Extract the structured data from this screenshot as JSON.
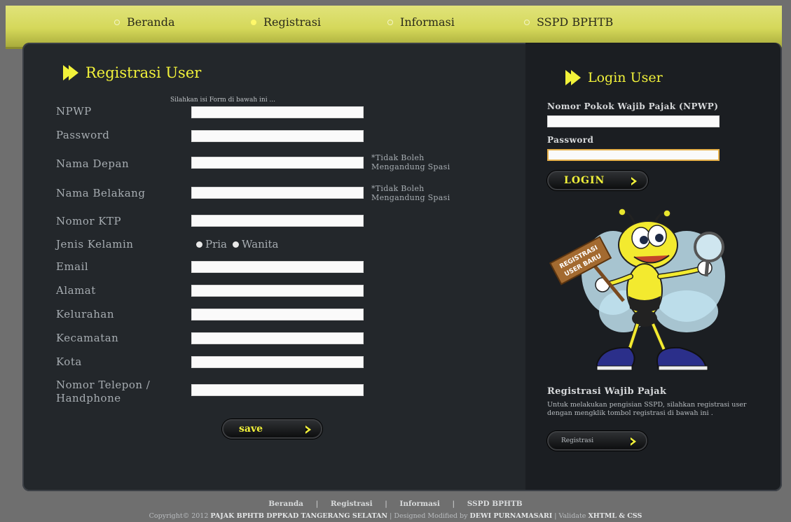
{
  "nav": {
    "items": [
      {
        "label": "Beranda",
        "active": false
      },
      {
        "label": "Registrasi",
        "active": true
      },
      {
        "label": "Informasi",
        "active": false
      },
      {
        "label": "SSPD BPHTB",
        "active": false
      }
    ]
  },
  "registration": {
    "title": "Registrasi User",
    "subtitle": "Silahkan isi Form di bawah ini ...",
    "fields": {
      "npwp": {
        "label": "NPWP",
        "value": ""
      },
      "password": {
        "label": "Password",
        "value": ""
      },
      "nama_depan": {
        "label": "Nama Depan",
        "value": "",
        "note": "*Tidak Boleh Mengandung Spasi"
      },
      "nama_belakang": {
        "label": "Nama Belakang",
        "value": "",
        "note": "*Tidak Boleh Mengandung Spasi"
      },
      "nomor_ktp": {
        "label": "Nomor KTP",
        "value": ""
      },
      "jenis_kelamin": {
        "label": "Jenis Kelamin",
        "options": [
          "Pria",
          "Wanita"
        ]
      },
      "email": {
        "label": "Email",
        "value": ""
      },
      "alamat": {
        "label": "Alamat",
        "value": ""
      },
      "kelurahan": {
        "label": "Kelurahan",
        "value": ""
      },
      "kecamatan": {
        "label": "Kecamatan",
        "value": ""
      },
      "kota": {
        "label": "Kota",
        "value": ""
      },
      "telepon": {
        "label": "Nomor Telepon / Handphone",
        "value": ""
      }
    },
    "save_label": "save"
  },
  "login": {
    "title": "Login User",
    "npwp_label": "Nomor Pokok Wajib Pajak (NPWP)",
    "password_label": "Password",
    "button_label": "LOGIN"
  },
  "mascot": {
    "sign_text": "REGISTRASI USER BARU"
  },
  "register_box": {
    "title": "Registrasi Wajib Pajak",
    "text": "Untuk melakukan pengisian SSPD, silahkan registrasi user dengan mengklik tombol registrasi di bawah ini .",
    "button_label": "Registrasi"
  },
  "footer": {
    "links": [
      "Beranda",
      "Registrasi",
      "Informasi",
      "SSPD BPHTB"
    ],
    "separator": "|",
    "copyright_prefix": "Copyright© 2012 ",
    "copyright_owner": "PAJAK BPHTB DPPKAD TANGERANG SELATAN",
    "designed": " | Designed Modified by ",
    "designer": "DEWI PURNAMASARI",
    "validate": " | Validate ",
    "validate_links": "XHTML & CSS"
  },
  "colors": {
    "accent": "#f2f23a",
    "nav_bg": "#d5d85a",
    "panel": "#23272b",
    "panel_dark": "#1b1e22",
    "page_bg": "#6f6f6f"
  }
}
